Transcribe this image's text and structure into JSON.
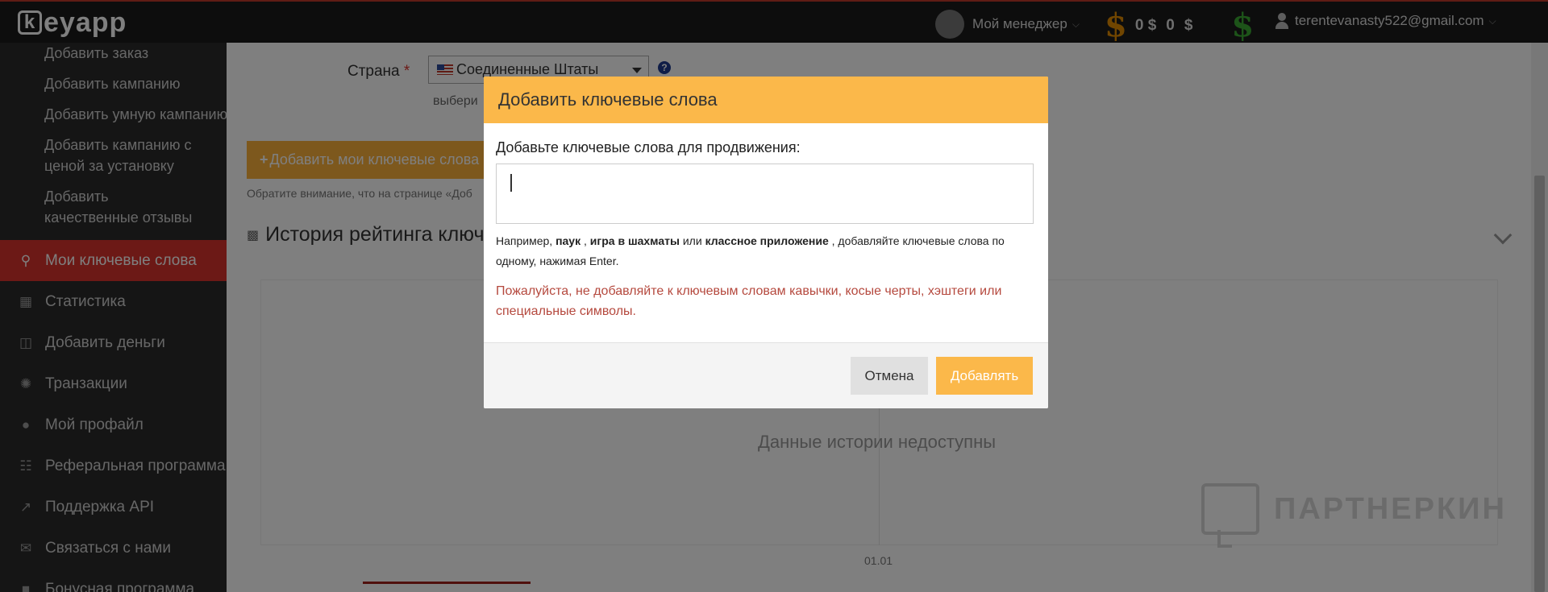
{
  "header": {
    "logo_text": "eyapp",
    "logo_k": "k",
    "manager_label": "Мой менеджер",
    "balance_1": "0 $",
    "balance_2": "0",
    "balance_currency": "$",
    "user_email": "terentevanasty522@gmail.com",
    "dollar_glyph": "$"
  },
  "sidebar": {
    "sub_items": [
      "Добавить заказ",
      "Добавить кампанию",
      "Добавить умную кампанию",
      "Добавить кампанию с ценой за установку",
      "Добавить качественные отзывы"
    ],
    "items": [
      {
        "label": "Мои ключевые слова",
        "icon": "key-icon",
        "active": true
      },
      {
        "label": "Статистика",
        "icon": "table-icon"
      },
      {
        "label": "Добавить деньги",
        "icon": "money-icon"
      },
      {
        "label": "Транзакции",
        "icon": "spinner-icon"
      },
      {
        "label": "Мой профайл",
        "icon": "user-icon"
      },
      {
        "label": "Реферальная программа",
        "icon": "sitemap-icon"
      },
      {
        "label": "Поддержка API",
        "icon": "external-link-icon"
      },
      {
        "label": "Связаться с нами",
        "icon": "mail-icon"
      },
      {
        "label": "Бонусная программа",
        "icon": "gift-icon"
      }
    ]
  },
  "main": {
    "country_label": "Страна",
    "required_mark": "*",
    "country_value": "Соединенные Штаты",
    "help_glyph": "?",
    "select_hint": "выбери",
    "add_keywords_button": "Добавить мои ключевые слова",
    "note": "Обратите внимание, что на странице «Доб",
    "history_title": "История рейтинга ключе",
    "no_data": "Данные истории недоступны",
    "chart_tick": "01.01"
  },
  "watermark": {
    "text": "ПАРТНЕРКИН"
  },
  "modal": {
    "title": "Добавить ключевые слова",
    "label": "Добавьте ключевые слова для продвижения:",
    "input_value": "",
    "help_prefix": "Например, ",
    "ex1": "паук",
    "sep1": " , ",
    "ex2": "игра в шахматы",
    "sep2": " или ",
    "ex3": "классное приложение",
    "help_suffix": " , добавляйте ключевые слова по одному, нажимая Enter.",
    "warning": "Пожалуйста, не добавляйте к ключевым словам кавычки, косые черты, хэштеги или специальные символы.",
    "cancel_label": "Отмена",
    "add_label": "Добавлять"
  },
  "colors": {
    "accent": "#fbb84a",
    "sidebar_active": "#d9332d",
    "warning_text": "#b5493e"
  }
}
